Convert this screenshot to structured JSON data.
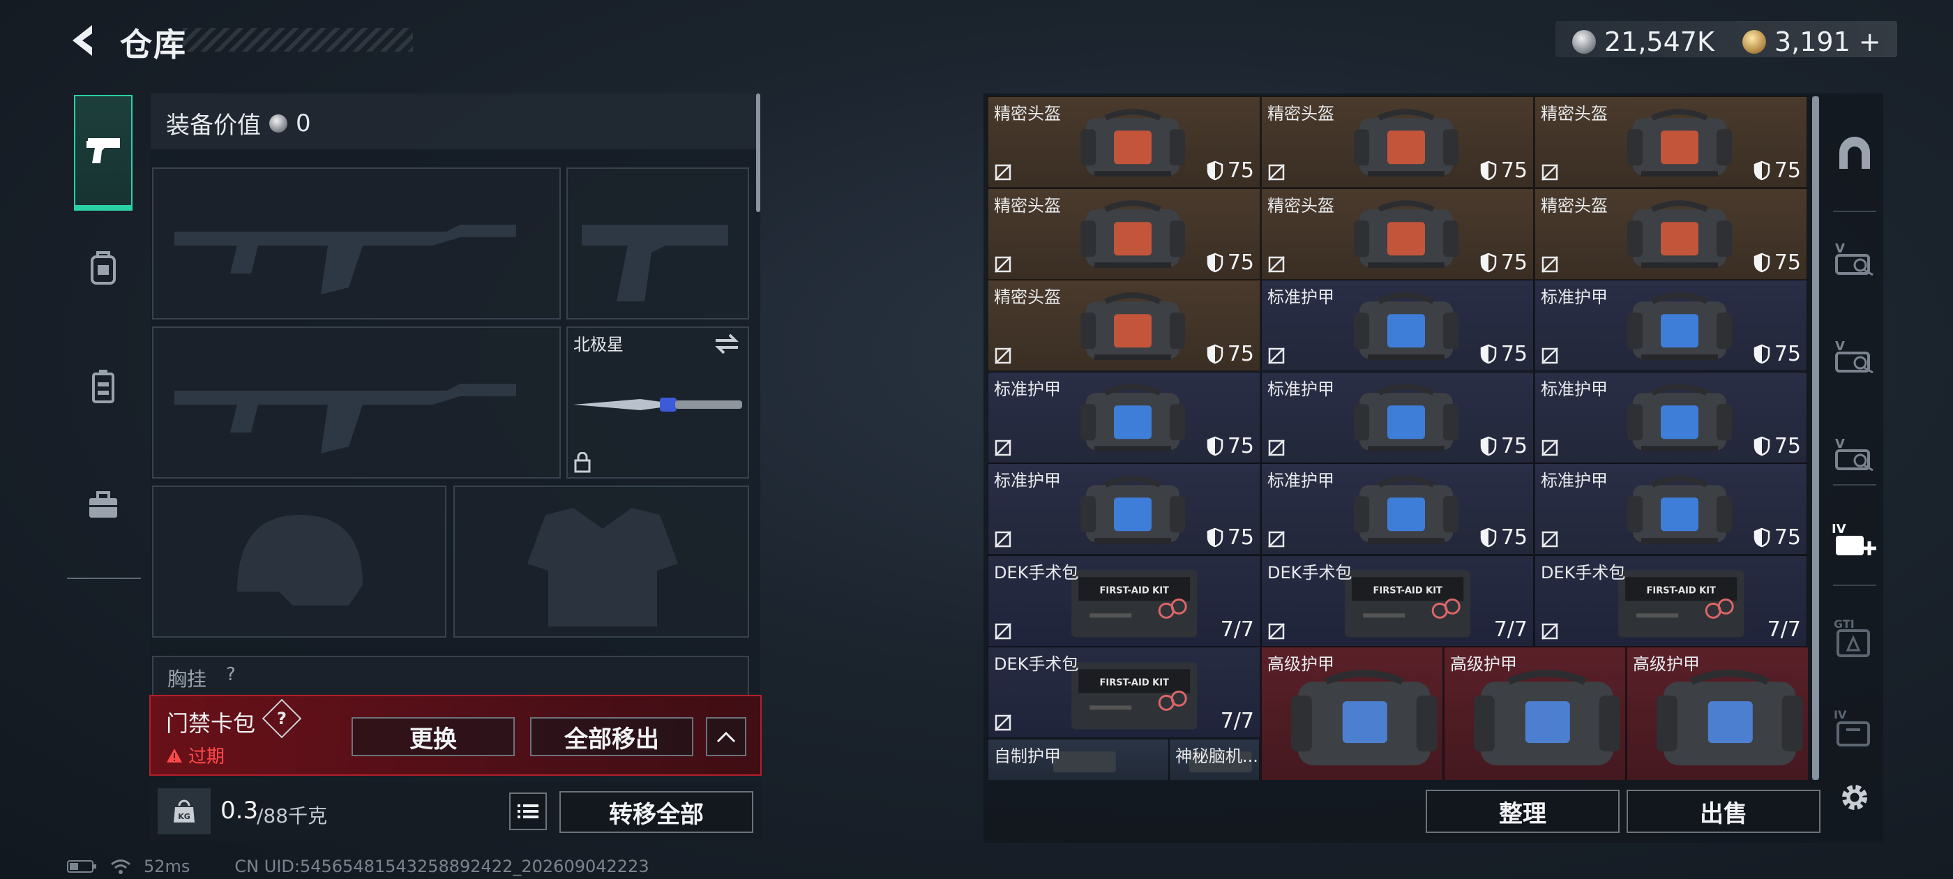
{
  "header": {
    "title": "仓库",
    "currencies": [
      {
        "icon": "silver-coin-icon",
        "value": "21,547K"
      },
      {
        "icon": "gold-coin-icon",
        "value": "3,191",
        "add": "+"
      }
    ]
  },
  "tabs": [
    {
      "icon": "pistol-icon",
      "active": true
    },
    {
      "icon": "backpack-icon",
      "active": false
    },
    {
      "icon": "vest-icon",
      "active": false
    },
    {
      "icon": "toolbox-icon",
      "active": false
    }
  ],
  "equipment": {
    "value_label": "装备价值",
    "value": "0",
    "melee_name": "北极星",
    "chest_rig_label": "胸挂",
    "chest_rig_help": "?"
  },
  "card_bag": {
    "label": "门禁卡包",
    "help": "?",
    "status": "过期",
    "replace_button": "更换",
    "remove_all_button": "全部移出",
    "collapse_icon": "chevron-up-icon"
  },
  "capacity": {
    "current": "0.3",
    "max": "/88千克",
    "transfer_all_button": "转移全部"
  },
  "status_bar": {
    "ping": "52ms",
    "uid": "CN UID:54565481543258892422_202609042223"
  },
  "inventory": {
    "rows": [
      [
        {
          "name": "精密头盔",
          "value": "75",
          "kind": "helmet"
        },
        {
          "name": "精密头盔",
          "value": "75",
          "kind": "helmet"
        },
        {
          "name": "精密头盔",
          "value": "75",
          "kind": "helmet"
        }
      ],
      [
        {
          "name": "精密头盔",
          "value": "75",
          "kind": "helmet"
        },
        {
          "name": "精密头盔",
          "value": "75",
          "kind": "helmet"
        },
        {
          "name": "精密头盔",
          "value": "75",
          "kind": "helmet"
        }
      ],
      [
        {
          "name": "精密头盔",
          "value": "75",
          "kind": "helmet"
        },
        {
          "name": "标准护甲",
          "value": "75",
          "kind": "armor"
        },
        {
          "name": "标准护甲",
          "value": "75",
          "kind": "armor"
        }
      ],
      [
        {
          "name": "标准护甲",
          "value": "75",
          "kind": "armor"
        },
        {
          "name": "标准护甲",
          "value": "75",
          "kind": "armor"
        },
        {
          "name": "标准护甲",
          "value": "75",
          "kind": "armor"
        }
      ],
      [
        {
          "name": "标准护甲",
          "value": "75",
          "kind": "armor"
        },
        {
          "name": "标准护甲",
          "value": "75",
          "kind": "armor"
        },
        {
          "name": "标准护甲",
          "value": "75",
          "kind": "armor"
        }
      ],
      [
        {
          "name": "DEK手术包",
          "value": "7/7",
          "kind": "kit"
        },
        {
          "name": "DEK手术包",
          "value": "7/7",
          "kind": "kit"
        },
        {
          "name": "DEK手术包",
          "value": "7/7",
          "kind": "kit"
        }
      ]
    ],
    "last_row": {
      "kit": {
        "name": "DEK手术包",
        "value": "7/7"
      },
      "big_armor": [
        {
          "name": "高级护甲"
        },
        {
          "name": "高级护甲"
        },
        {
          "name": "高级护甲"
        }
      ],
      "small": [
        {
          "name": "自制护甲"
        },
        {
          "name": "神秘脑机..."
        }
      ]
    },
    "sort_button": "整理",
    "sell_button": "出售"
  },
  "rail": [
    {
      "icon": "helmet-slot-icon"
    },
    {
      "icon": "vest-slot-1-icon",
      "label": "V"
    },
    {
      "icon": "vest-slot-2-icon",
      "label": "V"
    },
    {
      "icon": "vest-slot-3-icon",
      "label": "V"
    },
    {
      "icon": "add-storage-icon",
      "label": "IV"
    },
    {
      "icon": "gti-storage-icon",
      "label": "GTI"
    },
    {
      "icon": "storage-iv-icon",
      "label": "IV"
    },
    {
      "icon": "settings-gear-icon"
    }
  ]
}
